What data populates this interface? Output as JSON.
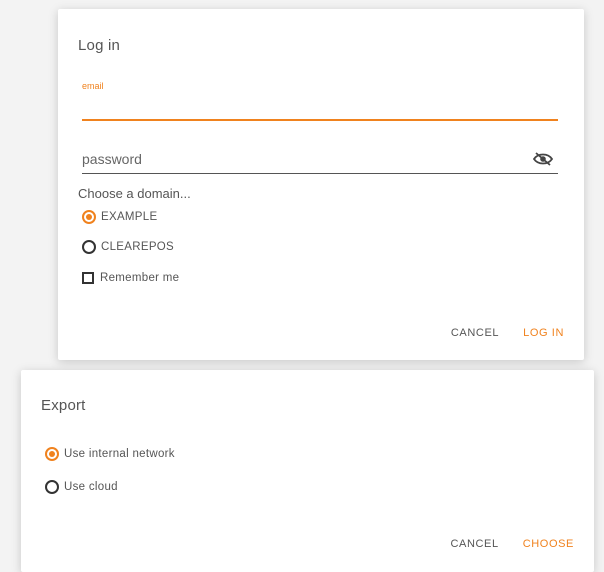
{
  "login": {
    "title": "Log in",
    "email": {
      "label": "email",
      "value": "",
      "placeholder": ""
    },
    "password": {
      "value": "",
      "placeholder": "password"
    },
    "domain_label": "Choose a domain...",
    "options": [
      {
        "label": "EXAMPLE",
        "checked": true
      },
      {
        "label": "CLEAREPOS",
        "checked": false
      }
    ],
    "remember_label": "Remember me",
    "cancel_label": "Cancel",
    "login_label": "Log in"
  },
  "export": {
    "title": "Export",
    "options": [
      {
        "label": "Use internal network",
        "checked": true
      },
      {
        "label": "Use cloud",
        "checked": false
      }
    ],
    "cancel_label": "Cancel",
    "confirm_label": "Choose"
  },
  "colors": {
    "accent": "#f0821e",
    "text": "#555555"
  }
}
